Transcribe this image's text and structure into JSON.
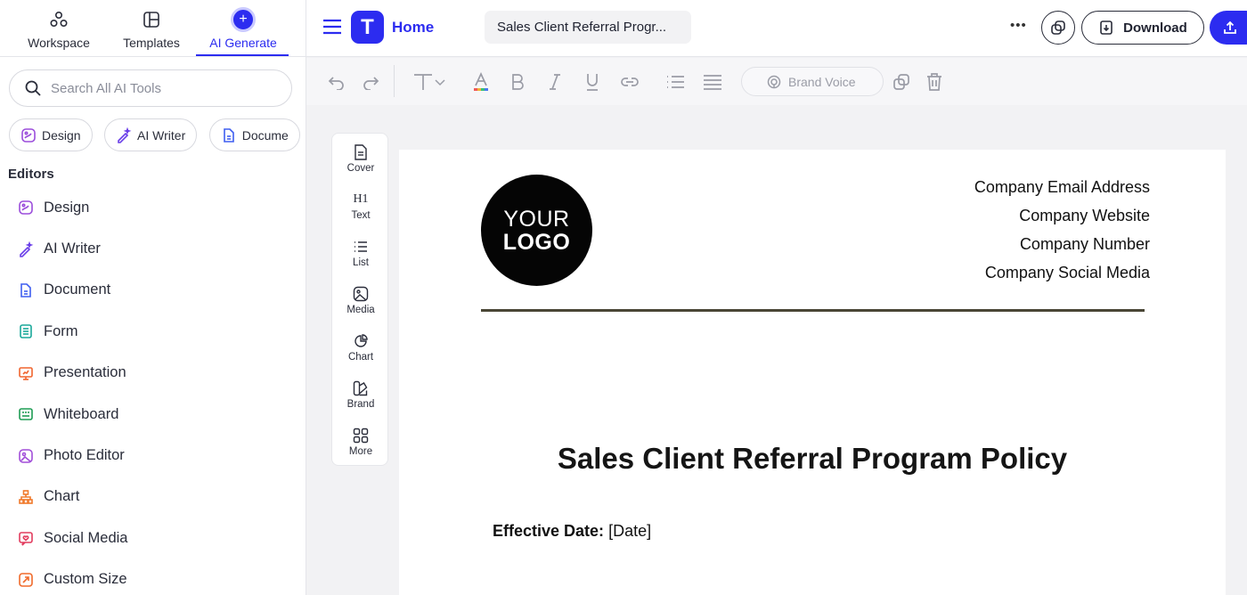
{
  "sidebar": {
    "tabs": [
      {
        "label": "Workspace",
        "icon": "workspace-icon"
      },
      {
        "label": "Templates",
        "icon": "templates-icon"
      },
      {
        "label": "AI Generate",
        "icon": "ai-generate-icon",
        "active": true
      }
    ],
    "search": {
      "placeholder": "Search All AI Tools",
      "value": ""
    },
    "chips": [
      {
        "label": "Design",
        "icon": "design-icon"
      },
      {
        "label": "AI Writer",
        "icon": "ai-writer-icon"
      },
      {
        "label": "Docume",
        "icon": "document-icon"
      }
    ],
    "editors_heading": "Editors",
    "editors": [
      {
        "label": "Design",
        "icon": "design-icon",
        "color": "#9b4ddb"
      },
      {
        "label": "AI Writer",
        "icon": "ai-writer-icon",
        "color": "#6a3ee8"
      },
      {
        "label": "Document",
        "icon": "document-icon",
        "color": "#3f5ef0"
      },
      {
        "label": "Form",
        "icon": "form-icon",
        "color": "#1aa89a"
      },
      {
        "label": "Presentation",
        "icon": "presentation-icon",
        "color": "#f0652f"
      },
      {
        "label": "Whiteboard",
        "icon": "whiteboard-icon",
        "color": "#1f9d55"
      },
      {
        "label": "Photo Editor",
        "icon": "photo-editor-icon",
        "color": "#a24fd9"
      },
      {
        "label": "Chart",
        "icon": "chart-icon",
        "color": "#f07a2b"
      },
      {
        "label": "Social Media",
        "icon": "social-media-icon",
        "color": "#e23d5f"
      },
      {
        "label": "Custom Size",
        "icon": "custom-size-icon",
        "color": "#f06a2b"
      }
    ]
  },
  "topbar": {
    "brand_letter": "T",
    "home_label": "Home",
    "doc_title": "Sales Client Referral Progr...",
    "more_label": "•••",
    "download_label": "Download"
  },
  "format_bar": {
    "brand_voice_label": "Brand Voice"
  },
  "rail": {
    "items": [
      {
        "label": "Cover",
        "icon": "cover-icon"
      },
      {
        "label": "Text",
        "icon": "text-h1-icon"
      },
      {
        "label": "List",
        "icon": "list-icon"
      },
      {
        "label": "Media",
        "icon": "media-icon"
      },
      {
        "label": "Chart",
        "icon": "chart-icon"
      },
      {
        "label": "Brand",
        "icon": "brand-icon"
      },
      {
        "label": "More",
        "icon": "more-grid-icon"
      }
    ],
    "text_glyph": "H1"
  },
  "document": {
    "logo_line1": "YOUR",
    "logo_line2": "LOGO",
    "contact": [
      "Company Email Address",
      "Company Website",
      "Company Number",
      "Company Social Media"
    ],
    "heading": "Sales Client Referral Program Policy",
    "effective_date_label": "Effective Date:",
    "effective_date_value": "[Date]"
  },
  "colors": {
    "accent": "#2c2cf0",
    "rule": "#4a4636"
  }
}
